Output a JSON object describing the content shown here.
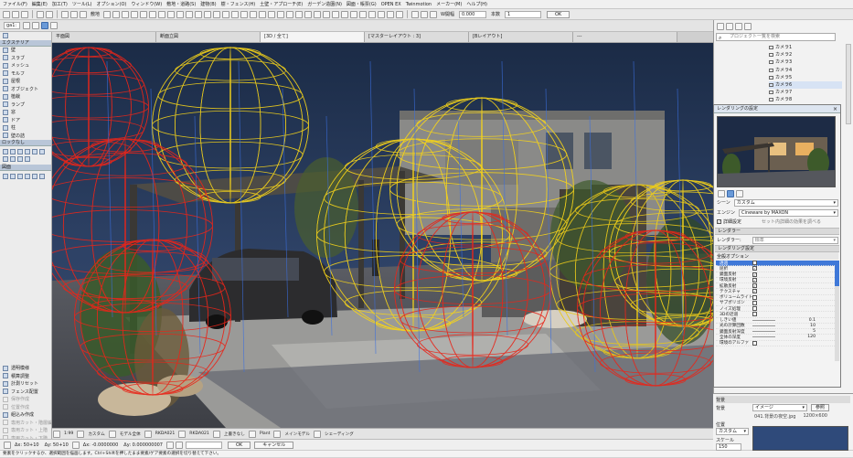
{
  "menubar": [
    "ファイル(F)",
    "編集(E)",
    "加工(T)",
    "ツール(L)",
    "オプション(O)",
    "ウィンドウ(W)",
    "敷地・道路(S)",
    "建物(B)",
    "樹・フェンス(H)",
    "土壁・アプローチ(E)",
    "ガーデン造園(N)",
    "図面・帳票(G)",
    "OPEN EX",
    "Twinmotion",
    "メーカー(M)",
    "ヘルプ(H)"
  ],
  "toolbar1": {
    "layer": "敷地",
    "zoom": "1:100",
    "width_label": "W開幅",
    "width_value": "0.000",
    "count_label": "本数",
    "count_value": "1",
    "ok": "OK"
  },
  "toolbar2": {
    "left_field": "ga1:",
    "search_placeholder": "プロジェクト一覧を検索"
  },
  "tabs": [
    "平面図",
    "断面立図",
    "[3D / 全て]",
    "[マスターレイアウト : 3]",
    "[Bレイアウト]",
    "---"
  ],
  "left_toolbox": {
    "section1_title": "エクステリア",
    "items1": [
      "壁",
      "スラブ",
      "メッシュ",
      "モルフ",
      "屋根",
      "オブジェクト",
      "植栽",
      "ランプ",
      "窓",
      "ドア",
      "柱",
      "壁の詰"
    ],
    "section2_title": "ロックなし",
    "section3_title": "図面",
    "items_bottom": [
      "透明模様",
      "積算調整",
      "計測リセット",
      "フェンス配置",
      "保存作成",
      "位置作成",
      "組込み作成",
      "専用カット・階層編集",
      "専用カット・上階",
      "専用カット・下階",
      "図面作成"
    ]
  },
  "navigator": {
    "items": [
      "カメラ1",
      "カメラ2",
      "カメラ3",
      "カメラ4",
      "カメラ5",
      "カメラ6",
      "カメラ7",
      "カメラ8"
    ],
    "selected_index": 5
  },
  "render_panel": {
    "title": "レンダリングの設定",
    "scene_label": "シーン",
    "scene_value": "カスタム",
    "engine_label": "エンジン",
    "engine_value": "Cineware by MAXON",
    "detail_label": "詳細設定",
    "detail_note": "セット内詳細の効果を調べる",
    "renderer_section": "レンダラー",
    "renderer_label": "レンダラー:",
    "renderer_value": "標準",
    "settings_section": "レンダリング設定",
    "settings_sub": "全般オプション",
    "rows": [
      {
        "label": "透過",
        "type": "check",
        "checked": true
      },
      {
        "label": "屈折",
        "type": "check",
        "checked": true
      },
      {
        "label": "鏡面反射",
        "type": "check",
        "checked": true
      },
      {
        "label": "環境反射",
        "type": "check",
        "checked": true
      },
      {
        "label": "拡散反射",
        "type": "check",
        "checked": true
      },
      {
        "label": "テクスチャ",
        "type": "check",
        "checked": true
      },
      {
        "label": "ボリュームライト",
        "type": "check",
        "checked": false
      },
      {
        "label": "サブポリゴン",
        "type": "check",
        "checked": false
      },
      {
        "label": "ノイズ処理",
        "type": "check",
        "checked": false
      },
      {
        "label": "3Dの近道",
        "type": "check",
        "checked": false
      },
      {
        "label": "しきい値",
        "type": "value",
        "value": "0.1"
      },
      {
        "label": "光の計算回数",
        "type": "value",
        "value": "10"
      },
      {
        "label": "鏡面反射深度",
        "type": "value",
        "value": "5"
      },
      {
        "label": "全体の深度",
        "type": "value",
        "value": "120"
      },
      {
        "label": "環境のアルファ",
        "type": "check",
        "checked": false
      }
    ]
  },
  "background": {
    "section": "背景",
    "type_label": "背景",
    "type_value": "イメージ",
    "browse": "参照",
    "image_name": "041.背景の夜空.jpg",
    "image_size": "1200×600",
    "scale_label": "位置",
    "scale_value": "カスタム",
    "scale2_label": "スケール",
    "scale2_value": "150"
  },
  "statusbar": [
    "1:99",
    "カスタム",
    "モデル全体",
    "RKDA021",
    "RKDA021",
    "上書きなし",
    "Plant",
    "メインモデル",
    "シェーディング"
  ],
  "infobar": {
    "x1": "Δx: 50+10",
    "y1": "Δy: 50+10",
    "x2": "Δx: -0.0000000",
    "y2": "Δy: 0.000000007",
    "ok": "OK",
    "cancel": "キャンセル"
  },
  "hint": "要素をクリックするか、選択範囲を描画します。Ctrl+Shiftを押したまま要素/ゲア要素の選択を切り替えて下さい。",
  "colors": {
    "accent": "#3f78d8",
    "sky": "#1e2f4a",
    "wire_red": "#e8261a",
    "wire_yellow": "#f6d41a"
  }
}
